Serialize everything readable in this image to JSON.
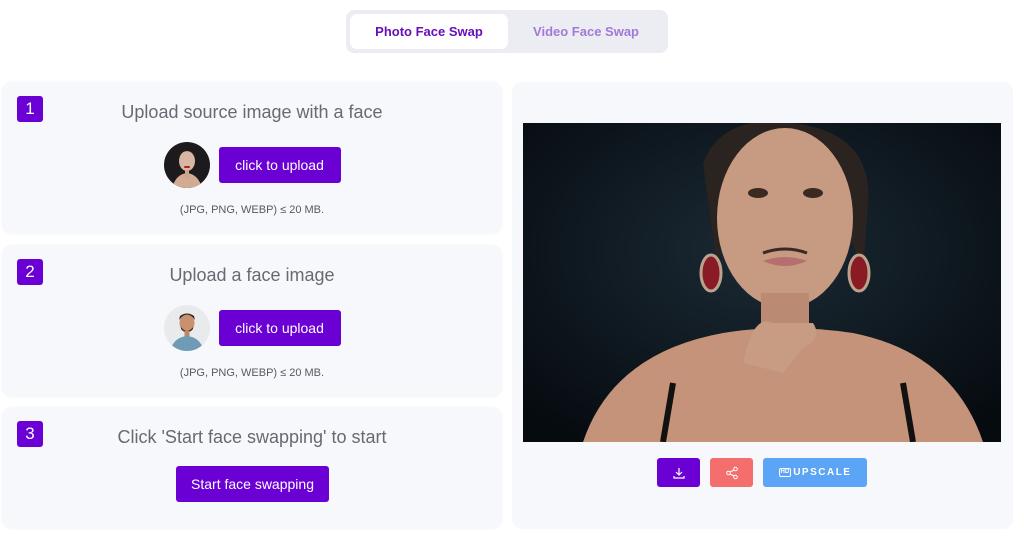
{
  "tabs": [
    {
      "label": "Photo Face Swap",
      "active": true
    },
    {
      "label": "Video Face Swap",
      "active": false
    }
  ],
  "steps": [
    {
      "number": "1",
      "title": "Upload source image with a face",
      "button": "click to upload",
      "hint": "(JPG, PNG, WEBP) ≤ 20 MB.",
      "avatar": "woman-portrait-thumbnail"
    },
    {
      "number": "2",
      "title": "Upload a face image",
      "button": "click to upload",
      "hint": "(JPG, PNG, WEBP) ≤ 20 MB.",
      "avatar": "man-portrait-thumbnail"
    },
    {
      "number": "3",
      "title": "Click 'Start face swapping' to start",
      "button": "Start face swapping"
    }
  ],
  "result": {
    "image": "face-swap-result-portrait",
    "actions": {
      "download_icon": "download-icon",
      "share_icon": "share-icon",
      "upscale_badge": "HD",
      "upscale_label": "UPSCALE"
    }
  },
  "colors": {
    "primary": "#6a00d4",
    "share": "#f46e6e",
    "upscale": "#5ba4f6",
    "card_bg": "#f7f8fb"
  }
}
